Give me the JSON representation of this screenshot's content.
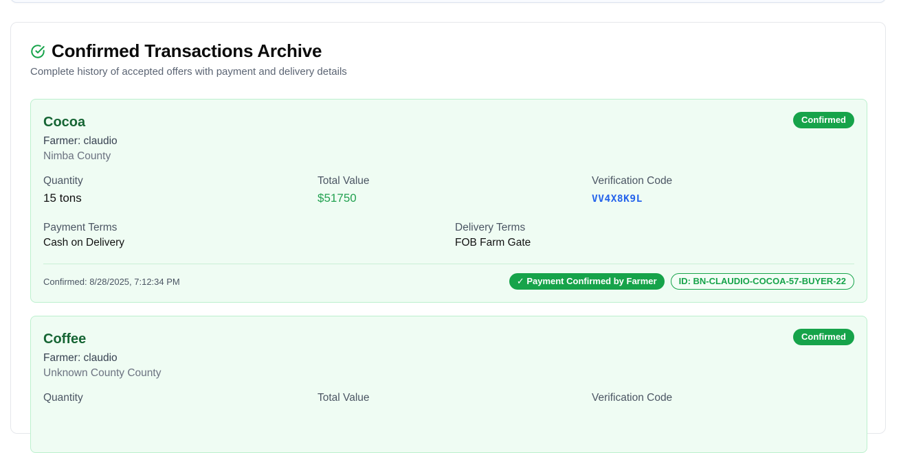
{
  "archive": {
    "title": "Confirmed Transactions Archive",
    "subtitle": "Complete history of accepted offers with payment and delivery details"
  },
  "labels": {
    "quantity": "Quantity",
    "total_value": "Total Value",
    "verification_code": "Verification Code",
    "payment_terms": "Payment Terms",
    "delivery_terms": "Delivery Terms"
  },
  "transactions": [
    {
      "crop": "Cocoa",
      "farmer": "Farmer: claudio",
      "county": "Nimba County",
      "status": "Confirmed",
      "quantity": "15 tons",
      "total_value": "$51750",
      "verification_code": "VV4X8K9L",
      "payment_terms": "Cash on Delivery",
      "delivery_terms": "FOB Farm Gate",
      "confirmed_at": "Confirmed: 8/28/2025, 7:12:34 PM",
      "payment_badge": "✓ Payment Confirmed by Farmer",
      "transaction_id": "ID: BN-CLAUDIO-COCOA-57-BUYER-22"
    },
    {
      "crop": "Coffee",
      "farmer": "Farmer: claudio",
      "county": "Unknown County County",
      "status": "Confirmed"
    }
  ],
  "colors": {
    "accent_green": "#16a34a",
    "card_bg": "#effcf3",
    "code_blue": "#2563eb"
  },
  "icons": {
    "header": "check-circle-icon"
  }
}
